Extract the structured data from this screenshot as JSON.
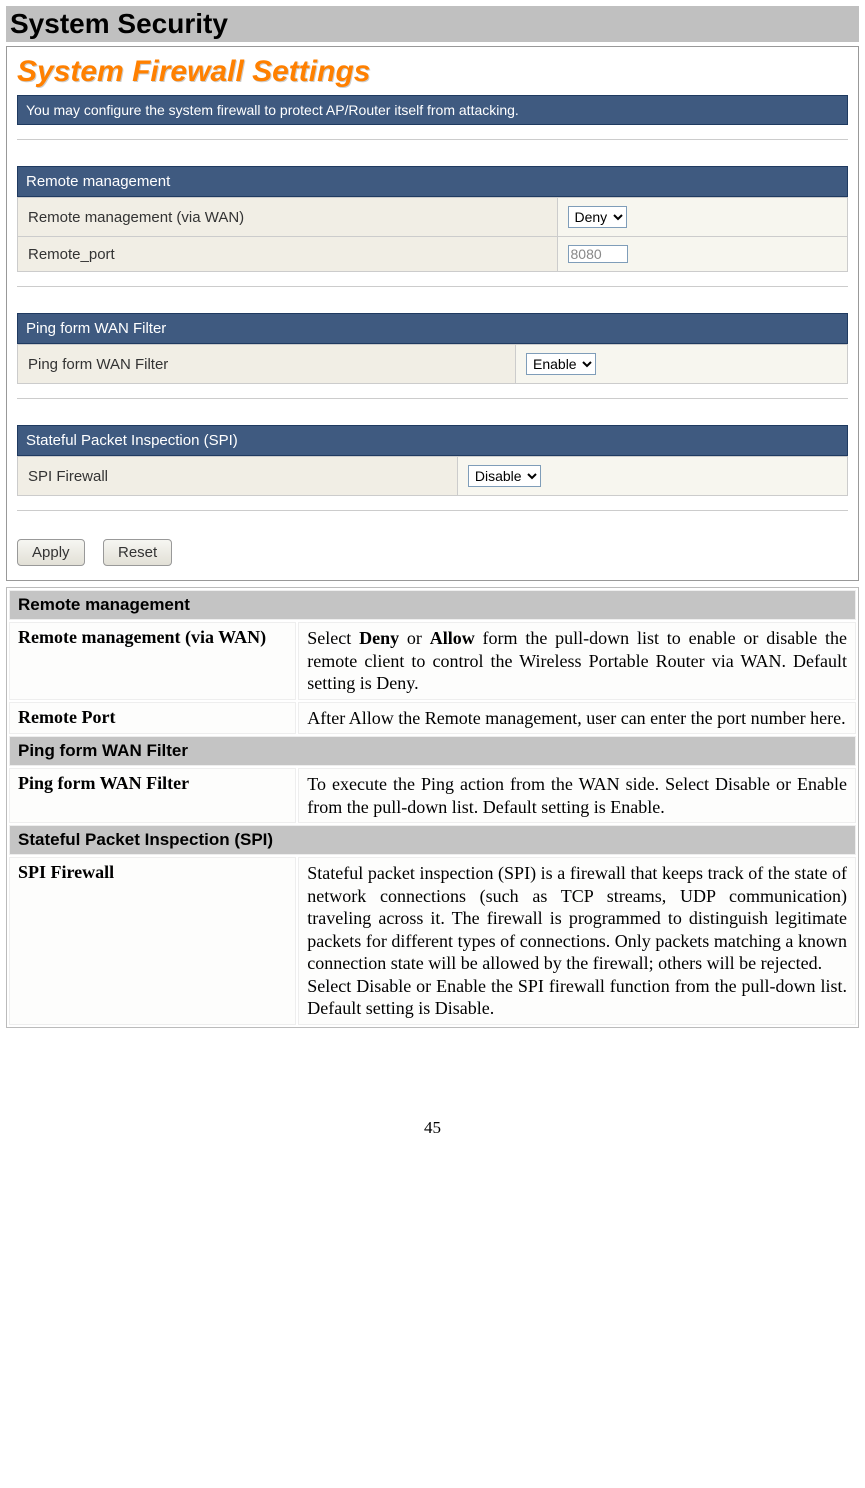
{
  "page": {
    "title": "System Security",
    "number": "45"
  },
  "panel": {
    "heading": "System Firewall Settings",
    "description": "You may configure the system firewall to protect AP/Router itself from attacking.",
    "sections": {
      "remote": {
        "header": "Remote management",
        "rows": {
          "via_wan": {
            "label": "Remote management (via WAN)",
            "value": "Deny"
          },
          "port": {
            "label": "Remote_port",
            "value": "8080"
          }
        }
      },
      "ping": {
        "header": "Ping form WAN Filter",
        "rows": {
          "filter": {
            "label": "Ping form WAN Filter",
            "value": "Enable"
          }
        }
      },
      "spi": {
        "header": "Stateful Packet Inspection (SPI)",
        "rows": {
          "firewall": {
            "label": "SPI Firewall",
            "value": "Disable"
          }
        }
      }
    },
    "buttons": {
      "apply": "Apply",
      "reset": "Reset"
    }
  },
  "help": {
    "remote": {
      "header": "Remote management",
      "via_wan": {
        "label": "Remote management (via WAN)",
        "desc_prefix": "Select ",
        "bold1": "Deny",
        "mid1": " or ",
        "bold2": "Allow",
        "desc_suffix": " form the pull-down list to enable or disable the remote client to control the Wireless Portable Router via WAN. Default setting is Deny."
      },
      "port": {
        "label": "Remote Port",
        "desc": "After Allow the Remote management, user can enter the port number here."
      }
    },
    "ping": {
      "header": "Ping form WAN Filter",
      "filter": {
        "label": "Ping form WAN Filter",
        "desc": "To execute the Ping action from the WAN side. Select Disable or Enable from the pull-down list. Default setting is Enable."
      }
    },
    "spi": {
      "header": "Stateful Packet Inspection (SPI)",
      "firewall": {
        "label": "SPI Firewall",
        "desc1": "Stateful packet inspection (SPI) is a firewall that keeps track of the state of network connections (such as TCP streams, UDP communication) traveling across it. The firewall is programmed to distinguish legitimate packets for different types of connections. Only packets matching a known connection state will be allowed by the firewall; others will be rejected.",
        "desc2": "Select Disable or Enable the SPI firewall function from the pull-down list. Default setting is Disable."
      }
    }
  }
}
